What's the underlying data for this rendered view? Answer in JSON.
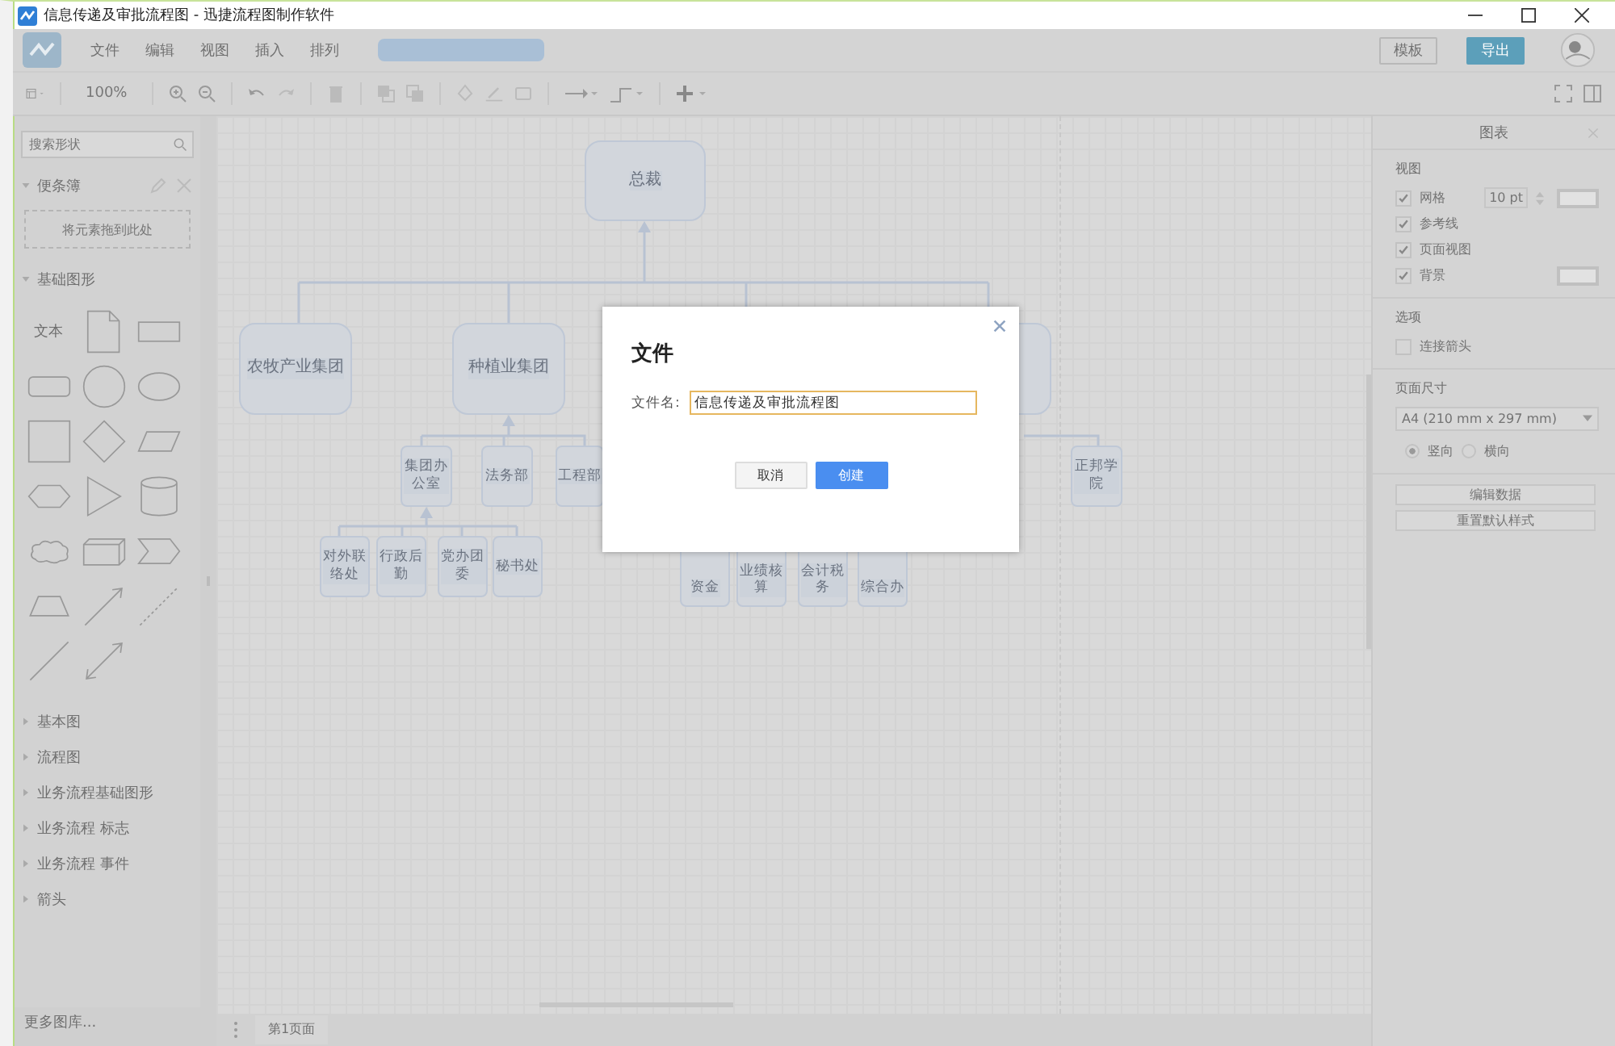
{
  "window": {
    "title": "信息传递及审批流程图 - 迅捷流程图制作软件"
  },
  "menu": [
    {
      "label": "文件"
    },
    {
      "label": "编辑"
    },
    {
      "label": "视图"
    },
    {
      "label": "插入"
    },
    {
      "label": "排列"
    }
  ],
  "header_buttons": [
    {
      "label": "模板",
      "kind": "outline"
    },
    {
      "label": "导出",
      "kind": "primary"
    }
  ],
  "toolbar": {
    "zoom": "100%"
  },
  "sidebar": {
    "search": {
      "placeholder": "搜索形状"
    },
    "scratchpad": {
      "title": "便条簿",
      "expanded": true,
      "drop_hint": "将元素拖到此处"
    },
    "basic_shapes": {
      "title": "基础图形",
      "expanded": true,
      "text_shape": "文本"
    },
    "sections": [
      {
        "title": "基本图",
        "expanded": false
      },
      {
        "title": "流程图",
        "expanded": false
      },
      {
        "title": "业务流程基础图形",
        "expanded": false
      },
      {
        "title": "业务流程 标志",
        "expanded": false
      },
      {
        "title": "业务流程 事件",
        "expanded": false
      },
      {
        "title": "箭头",
        "expanded": false
      }
    ],
    "more": "更多图库..."
  },
  "diagram": {
    "label": "总裁",
    "children": [
      {
        "label": "农牧产业集团"
      },
      {
        "label": "种植业集团",
        "children": [
          {
            "label": "集团办公室",
            "children": [
              {
                "label": "对外联络处"
              },
              {
                "label": "行政后勤"
              },
              {
                "label": "党办团委"
              },
              {
                "label": "秘书处"
              }
            ]
          },
          {
            "label": "法务部"
          },
          {
            "label": "工程部"
          }
        ]
      },
      {
        "children": [
          {
            "label": "资金"
          },
          {
            "label": "业绩核算"
          },
          {
            "label": "会计税务"
          },
          {
            "label": "综合办"
          }
        ]
      },
      {
        "children": [
          {
            "label": "正邦学院"
          }
        ]
      }
    ]
  },
  "page_tab": "第1页面",
  "format_panel": {
    "title": "图表",
    "view_title": "视图",
    "options": [
      {
        "label": "网格",
        "checked": true
      },
      {
        "label": "参考线",
        "checked": true
      },
      {
        "label": "页面视图",
        "checked": true
      },
      {
        "label": "背景",
        "checked": true
      }
    ],
    "grid_size": "10 pt",
    "options_title": "选项",
    "connect_arrows": {
      "label": "连接箭头",
      "checked": false
    },
    "page_size_title": "页面尺寸",
    "page_size": "A4 (210 mm x 297 mm)",
    "orientation": [
      {
        "label": "竖向",
        "selected": true
      },
      {
        "label": "横向",
        "selected": false
      }
    ],
    "buttons": [
      "编辑数据",
      "重置默认样式"
    ]
  },
  "dialog": {
    "title": "文件",
    "field_label": "文件名:",
    "file_name": "信息传递及审批流程图",
    "buttons": [
      {
        "label": "取消",
        "kind": "secondary"
      },
      {
        "label": "创建",
        "kind": "primary"
      }
    ]
  }
}
